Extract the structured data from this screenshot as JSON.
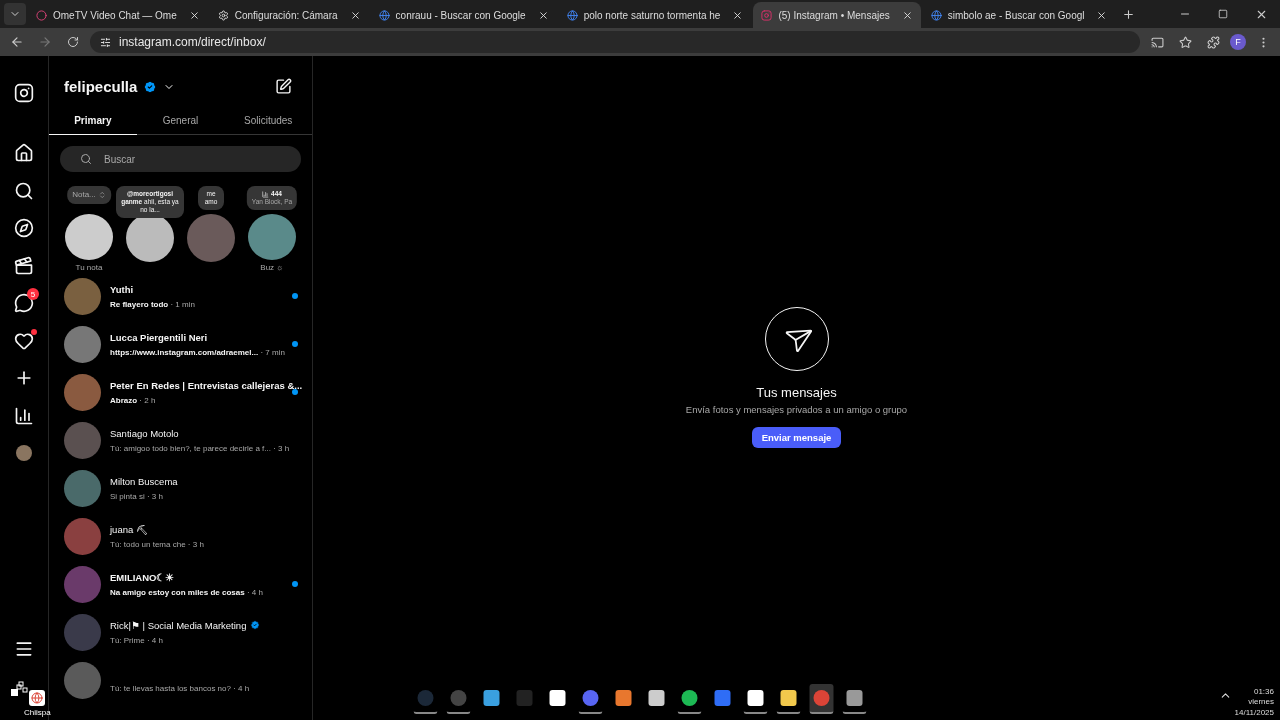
{
  "browser": {
    "tabs": [
      {
        "title": "OmeTV Video Chat — Ome",
        "kind": "recording",
        "selected": false
      },
      {
        "title": "Configuración: Cámara",
        "kind": "settings",
        "selected": false
      },
      {
        "title": "conrauu - Buscar con Google",
        "kind": "google",
        "selected": false
      },
      {
        "title": "polo norte saturno tormenta he",
        "kind": "google",
        "selected": false
      },
      {
        "title": "(5) Instagram • Mensajes",
        "kind": "instagram",
        "selected": true
      },
      {
        "title": "simbolo ae - Buscar con Googl",
        "kind": "google",
        "selected": false
      }
    ],
    "address": "instagram.com/direct/inbox/",
    "profile_initial": "F"
  },
  "nav": [
    {
      "kind": "home"
    },
    {
      "kind": "search"
    },
    {
      "kind": "explore"
    },
    {
      "kind": "reels"
    },
    {
      "kind": "messages",
      "badge": "5"
    },
    {
      "kind": "notifications",
      "dot": true
    },
    {
      "kind": "create"
    },
    {
      "kind": "dashboard"
    },
    {
      "kind": "profile"
    }
  ],
  "account": {
    "username": "felipeculla",
    "verified": true
  },
  "inbox_tabs": [
    {
      "label": "Primary",
      "selected": true
    },
    {
      "label": "General",
      "selected": false
    },
    {
      "label": "Solicitudes",
      "selected": false
    }
  ],
  "search": {
    "placeholder": "Buscar"
  },
  "notes": [
    {
      "kind": "own",
      "note": "Nota...",
      "label": "Tu nota"
    },
    {
      "kind": "text",
      "note": "**@moreortigosi ganme** ahii, esta ya no la..."
    },
    {
      "kind": "text",
      "note": "me amo"
    },
    {
      "kind": "music",
      "note": "444",
      "sub": "Yan Block, Pa",
      "label": "Buz ☼"
    }
  ],
  "conversations": [
    {
      "name": "Yuthi",
      "preview": "Re flayero todo",
      "time": "· 1 min",
      "unread": true,
      "verified": false
    },
    {
      "name": "Lucca Piergentili Neri",
      "preview": "https://www.instagram.com/adraemel...",
      "time": "· 7 min",
      "unread": true,
      "verified": false
    },
    {
      "name": "Peter En Redes | Entrevistas callejeras &...",
      "preview": "Abrazo",
      "time": "· 2 h",
      "unread": true,
      "verified": false
    },
    {
      "name": "Santiago Motolo",
      "preview": "Tú: amigoo todo bien?, te parece decirle a f...",
      "time": "· 3 h",
      "unread": false,
      "verified": false
    },
    {
      "name": "Milton Buscema",
      "preview": "Si pinta si",
      "time": "· 3 h",
      "unread": false,
      "verified": false
    },
    {
      "name": "juana ⛏",
      "preview": "Tú: todo un tema che",
      "time": "· 3 h",
      "unread": false,
      "verified": false
    },
    {
      "name": "EMILIANO☾☀",
      "preview": "Na amigo estoy con miles de cosas",
      "time": "· 4 h",
      "unread": true,
      "verified": false
    },
    {
      "name": "Rick|⚑ | Social Media Marketing",
      "preview": "Tú: Prime",
      "time": "· 4 h",
      "unread": false,
      "verified": true
    },
    {
      "preview": "Tú: te llevas hasta los bancos no?",
      "time": "· 4 h",
      "unread": false,
      "verified": false
    }
  ],
  "empty_state": {
    "title": "Tus mensajes",
    "subtitle": "Envía fotos y mensajes privados a un amigo o grupo",
    "button": "Enviar mensaje"
  },
  "desktop": {
    "shortcut": "Chiispa"
  },
  "taskbar": {
    "apps": [
      {
        "kind": "steam",
        "running": true,
        "selected": false
      },
      {
        "kind": "obs",
        "running": true,
        "selected": false
      },
      {
        "kind": "fortnite",
        "running": false,
        "selected": false
      },
      {
        "kind": "epic",
        "running": false,
        "selected": false
      },
      {
        "kind": "capcut",
        "running": false,
        "selected": false
      },
      {
        "kind": "discord",
        "running": true,
        "selected": false
      },
      {
        "kind": "launcher",
        "running": false,
        "selected": false
      },
      {
        "kind": "roblox",
        "running": false,
        "selected": false
      },
      {
        "kind": "spotify",
        "running": true,
        "selected": false
      },
      {
        "kind": "robloxstudio",
        "running": false,
        "selected": false
      },
      {
        "kind": "capcut",
        "running": true,
        "selected": false
      },
      {
        "kind": "explorer",
        "running": true,
        "selected": false
      },
      {
        "kind": "chrome",
        "running": true,
        "selected": true
      },
      {
        "kind": "mouse",
        "running": true,
        "selected": false
      }
    ],
    "time": "01:36",
    "day": "viernes",
    "date": "14/11/2025"
  }
}
